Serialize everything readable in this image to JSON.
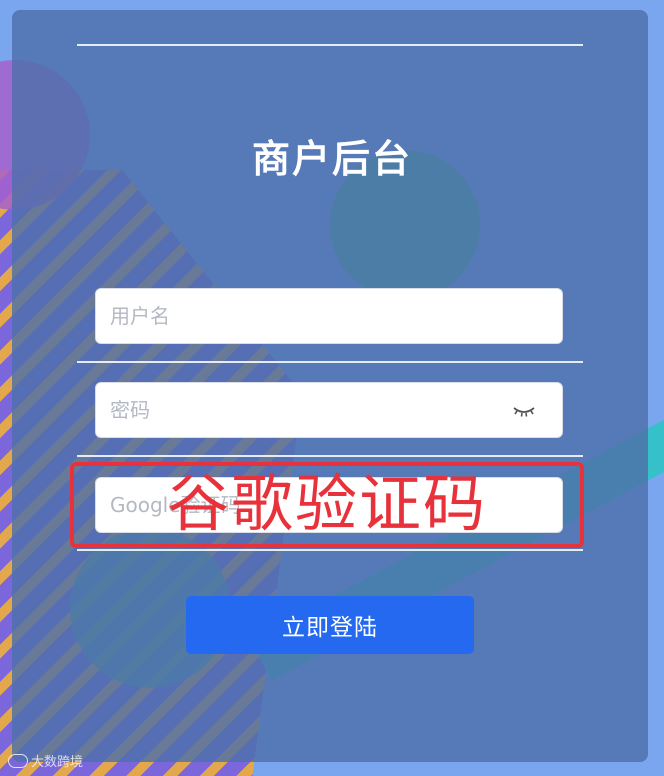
{
  "login": {
    "title": "商户后台",
    "username_placeholder": "用户名",
    "password_placeholder": "密码",
    "google_code_placeholder": "Google验证码",
    "submit_label": "立即登陆"
  },
  "annotation": {
    "text": "谷歌验证码",
    "color": "#e8323b"
  },
  "watermark": {
    "text": "大数跨境"
  },
  "icons": {
    "password_toggle": "eye-closed-icon"
  },
  "colors": {
    "primary_button": "#2469f0",
    "card_overlay": "#4e70aa"
  }
}
